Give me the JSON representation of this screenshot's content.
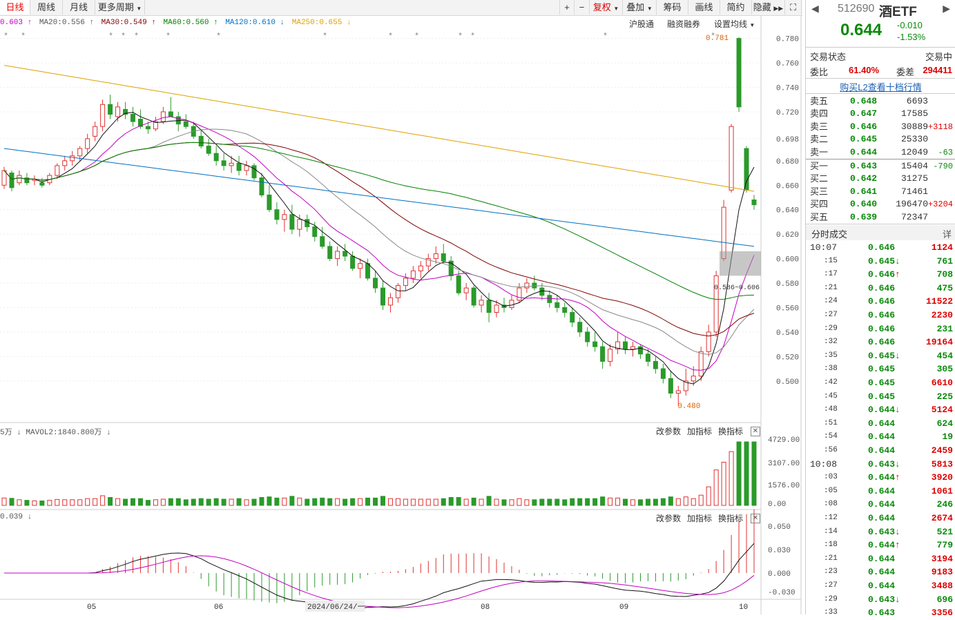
{
  "toolbar": {
    "tabs": [
      "日线",
      "周线",
      "月线",
      "更多周期"
    ],
    "right_buttons": [
      "+",
      "−",
      "复权",
      "叠加",
      "筹码",
      "画线",
      "简约",
      "隐藏"
    ]
  },
  "ma_legend": [
    {
      "text": "0.603 ↑",
      "color": "#c000c0"
    },
    {
      "text": "MA20:0.556 ↑",
      "color": "#555555"
    },
    {
      "text": "MA30:0.549 ↑",
      "color": "#800000"
    },
    {
      "text": "MA60:0.560 ↑",
      "color": "#008000"
    },
    {
      "text": "MA120:0.610 ↓",
      "color": "#0070c0"
    },
    {
      "text": "MA250:0.655 ↓",
      "color": "#e0a000"
    }
  ],
  "chart_links": [
    "沪股通",
    "融资融券",
    "设置均线"
  ],
  "chart_data": {
    "type": "candlestick",
    "price_axis": {
      "ticks": [
        "0.780",
        "0.760",
        "0.740",
        "0.720",
        "0.698",
        "0.680",
        "0.660",
        "0.640",
        "0.620",
        "0.600",
        "0.580",
        "0.560",
        "0.540",
        "0.520",
        "0.500"
      ],
      "ylim": [
        0.466,
        0.786
      ]
    },
    "annotations": {
      "high": "0.781",
      "low": "0.480",
      "range_label": "0.586~0.606"
    },
    "x_labels": [
      "05",
      "06",
      "2024/06/24/一",
      "08",
      "09",
      "10"
    ],
    "candles": [
      [
        0.66,
        0.675,
        0.657,
        0.672
      ],
      [
        0.67,
        0.672,
        0.655,
        0.658
      ],
      [
        0.662,
        0.672,
        0.66,
        0.668
      ],
      [
        0.666,
        0.67,
        0.66,
        0.662
      ],
      [
        0.664,
        0.668,
        0.66,
        0.665
      ],
      [
        0.662,
        0.666,
        0.658,
        0.66
      ],
      [
        0.662,
        0.67,
        0.66,
        0.668
      ],
      [
        0.668,
        0.678,
        0.665,
        0.676
      ],
      [
        0.676,
        0.684,
        0.672,
        0.68
      ],
      [
        0.68,
        0.688,
        0.676,
        0.684
      ],
      [
        0.684,
        0.692,
        0.68,
        0.69
      ],
      [
        0.69,
        0.702,
        0.686,
        0.698
      ],
      [
        0.7,
        0.712,
        0.696,
        0.708
      ],
      [
        0.708,
        0.73,
        0.704,
        0.726
      ],
      [
        0.726,
        0.734,
        0.714,
        0.718
      ],
      [
        0.716,
        0.728,
        0.712,
        0.724
      ],
      [
        0.722,
        0.728,
        0.714,
        0.718
      ],
      [
        0.718,
        0.724,
        0.708,
        0.712
      ],
      [
        0.714,
        0.722,
        0.706,
        0.708
      ],
      [
        0.708,
        0.712,
        0.702,
        0.706
      ],
      [
        0.706,
        0.716,
        0.704,
        0.712
      ],
      [
        0.712,
        0.724,
        0.71,
        0.72
      ],
      [
        0.72,
        0.732,
        0.716,
        0.716
      ],
      [
        0.716,
        0.72,
        0.704,
        0.71
      ],
      [
        0.712,
        0.718,
        0.706,
        0.708
      ],
      [
        0.708,
        0.712,
        0.698,
        0.7
      ],
      [
        0.7,
        0.706,
        0.69,
        0.692
      ],
      [
        0.692,
        0.698,
        0.684,
        0.686
      ],
      [
        0.686,
        0.692,
        0.676,
        0.68
      ],
      [
        0.68,
        0.686,
        0.672,
        0.676
      ],
      [
        0.676,
        0.684,
        0.67,
        0.678
      ],
      [
        0.678,
        0.684,
        0.668,
        0.672
      ],
      [
        0.672,
        0.68,
        0.668,
        0.676
      ],
      [
        0.676,
        0.678,
        0.664,
        0.666
      ],
      [
        0.666,
        0.67,
        0.65,
        0.652
      ],
      [
        0.652,
        0.66,
        0.638,
        0.64
      ],
      [
        0.64,
        0.646,
        0.628,
        0.632
      ],
      [
        0.632,
        0.64,
        0.622,
        0.636
      ],
      [
        0.636,
        0.644,
        0.62,
        0.624
      ],
      [
        0.624,
        0.636,
        0.618,
        0.632
      ],
      [
        0.632,
        0.636,
        0.622,
        0.626
      ],
      [
        0.626,
        0.63,
        0.614,
        0.618
      ],
      [
        0.618,
        0.626,
        0.608,
        0.61
      ],
      [
        0.61,
        0.614,
        0.598,
        0.6
      ],
      [
        0.6,
        0.61,
        0.594,
        0.606
      ],
      [
        0.606,
        0.612,
        0.598,
        0.602
      ],
      [
        0.602,
        0.606,
        0.59,
        0.592
      ],
      [
        0.592,
        0.6,
        0.584,
        0.596
      ],
      [
        0.596,
        0.6,
        0.582,
        0.584
      ],
      [
        0.584,
        0.59,
        0.572,
        0.576
      ],
      [
        0.576,
        0.582,
        0.558,
        0.562
      ],
      [
        0.562,
        0.572,
        0.556,
        0.568
      ],
      [
        0.568,
        0.58,
        0.564,
        0.578
      ],
      [
        0.578,
        0.588,
        0.574,
        0.584
      ],
      [
        0.584,
        0.594,
        0.58,
        0.59
      ],
      [
        0.59,
        0.598,
        0.584,
        0.594
      ],
      [
        0.594,
        0.604,
        0.59,
        0.6
      ],
      [
        0.6,
        0.61,
        0.596,
        0.604
      ],
      [
        0.604,
        0.612,
        0.596,
        0.598
      ],
      [
        0.598,
        0.602,
        0.582,
        0.586
      ],
      [
        0.586,
        0.59,
        0.57,
        0.572
      ],
      [
        0.572,
        0.58,
        0.566,
        0.576
      ],
      [
        0.576,
        0.578,
        0.56,
        0.562
      ],
      [
        0.562,
        0.57,
        0.556,
        0.566
      ],
      [
        0.566,
        0.572,
        0.548,
        0.556
      ],
      [
        0.556,
        0.566,
        0.552,
        0.562
      ],
      [
        0.562,
        0.568,
        0.556,
        0.56
      ],
      [
        0.56,
        0.57,
        0.558,
        0.566
      ],
      [
        0.566,
        0.58,
        0.564,
        0.576
      ],
      [
        0.576,
        0.584,
        0.572,
        0.58
      ],
      [
        0.58,
        0.586,
        0.574,
        0.576
      ],
      [
        0.576,
        0.58,
        0.566,
        0.57
      ],
      [
        0.57,
        0.574,
        0.56,
        0.564
      ],
      [
        0.564,
        0.57,
        0.556,
        0.56
      ],
      [
        0.56,
        0.564,
        0.552,
        0.556
      ],
      [
        0.556,
        0.56,
        0.544,
        0.548
      ],
      [
        0.548,
        0.552,
        0.536,
        0.54
      ],
      [
        0.54,
        0.544,
        0.528,
        0.532
      ],
      [
        0.532,
        0.54,
        0.524,
        0.528
      ],
      [
        0.528,
        0.532,
        0.51,
        0.516
      ],
      [
        0.516,
        0.53,
        0.512,
        0.526
      ],
      [
        0.526,
        0.54,
        0.522,
        0.532
      ],
      [
        0.532,
        0.536,
        0.522,
        0.526
      ],
      [
        0.526,
        0.532,
        0.52,
        0.528
      ],
      [
        0.528,
        0.53,
        0.518,
        0.522
      ],
      [
        0.522,
        0.526,
        0.512,
        0.516
      ],
      [
        0.516,
        0.52,
        0.506,
        0.51
      ],
      [
        0.51,
        0.514,
        0.498,
        0.502
      ],
      [
        0.502,
        0.508,
        0.486,
        0.49
      ],
      [
        0.49,
        0.496,
        0.48,
        0.492
      ],
      [
        0.492,
        0.51,
        0.488,
        0.5
      ],
      [
        0.5,
        0.512,
        0.496,
        0.504
      ],
      [
        0.504,
        0.528,
        0.5,
        0.524
      ],
      [
        0.524,
        0.546,
        0.52,
        0.54
      ],
      [
        0.54,
        0.59,
        0.536,
        0.586
      ],
      [
        0.6,
        0.648,
        0.598,
        0.642
      ],
      [
        0.656,
        0.71,
        0.654,
        0.708
      ],
      [
        0.78,
        0.781,
        0.72,
        0.724
      ],
      [
        0.69,
        0.692,
        0.654,
        0.656
      ],
      [
        0.648,
        0.652,
        0.64,
        0.644
      ]
    ]
  },
  "volume_panel": {
    "label": "5万 ↓ MAVOL2:1840.800万 ↓",
    "ticks": [
      "4729.00",
      "3107.00",
      "1576.00",
      "0.00"
    ],
    "links": [
      "改参数",
      "加指标",
      "换指标"
    ]
  },
  "macd_panel": {
    "label": "0.039 ↓",
    "ticks": [
      "0.050",
      "0.030",
      "0.000",
      "-0.030"
    ],
    "links": [
      "改参数",
      "加指标",
      "换指标"
    ]
  },
  "sidebar": {
    "code": "512690",
    "name": "酒ETF",
    "price": "0.644",
    "change": "-0.010",
    "change_pct": "-1.53%",
    "status_label": "交易状态",
    "status_value": "交易中",
    "ratio_label": "委比",
    "ratio_value": "61.40%",
    "diff_label": "委差",
    "diff_value": "294411",
    "l2_link": "购买L2查看十档行情",
    "asks": [
      {
        "label": "卖五",
        "price": "0.648",
        "vol": "6693",
        "chg": ""
      },
      {
        "label": "卖四",
        "price": "0.647",
        "vol": "17585",
        "chg": ""
      },
      {
        "label": "卖三",
        "price": "0.646",
        "vol": "30889",
        "chg": "+3118"
      },
      {
        "label": "卖二",
        "price": "0.645",
        "vol": "25330",
        "chg": ""
      },
      {
        "label": "卖一",
        "price": "0.644",
        "vol": "12049",
        "chg": "-63"
      }
    ],
    "bids": [
      {
        "label": "买一",
        "price": "0.643",
        "vol": "15404",
        "chg": "-790"
      },
      {
        "label": "买二",
        "price": "0.642",
        "vol": "31275",
        "chg": ""
      },
      {
        "label": "买三",
        "price": "0.641",
        "vol": "71461",
        "chg": ""
      },
      {
        "label": "买四",
        "price": "0.640",
        "vol": "196470",
        "chg": "+3204"
      },
      {
        "label": "买五",
        "price": "0.639",
        "vol": "72347",
        "chg": ""
      }
    ],
    "ticks_title": "分时成交",
    "ticks_detail": "详",
    "ticks": [
      {
        "t": "10:07",
        "p": "0.646",
        "a": "",
        "v": "1124"
      },
      {
        "t": ":15",
        "p": "0.645",
        "a": "↓",
        "v": "761"
      },
      {
        "t": ":17",
        "p": "0.646",
        "a": "↑",
        "v": "708"
      },
      {
        "t": ":21",
        "p": "0.646",
        "a": "",
        "v": "475"
      },
      {
        "t": ":24",
        "p": "0.646",
        "a": "",
        "v": "11522"
      },
      {
        "t": ":27",
        "p": "0.646",
        "a": "",
        "v": "2230"
      },
      {
        "t": ":29",
        "p": "0.646",
        "a": "",
        "v": "231"
      },
      {
        "t": ":32",
        "p": "0.646",
        "a": "",
        "v": "19164"
      },
      {
        "t": ":35",
        "p": "0.645",
        "a": "↓",
        "v": "454"
      },
      {
        "t": ":38",
        "p": "0.645",
        "a": "",
        "v": "305"
      },
      {
        "t": ":42",
        "p": "0.645",
        "a": "",
        "v": "6610"
      },
      {
        "t": ":45",
        "p": "0.645",
        "a": "",
        "v": "225"
      },
      {
        "t": ":48",
        "p": "0.644",
        "a": "↓",
        "v": "5124"
      },
      {
        "t": ":51",
        "p": "0.644",
        "a": "",
        "v": "624"
      },
      {
        "t": ":54",
        "p": "0.644",
        "a": "",
        "v": "19"
      },
      {
        "t": ":56",
        "p": "0.644",
        "a": "",
        "v": "2459"
      },
      {
        "t": "10:08",
        "p": "0.643",
        "a": "↓",
        "v": "5813"
      },
      {
        "t": ":03",
        "p": "0.644",
        "a": "↑",
        "v": "3920"
      },
      {
        "t": ":05",
        "p": "0.644",
        "a": "",
        "v": "1061"
      },
      {
        "t": ":08",
        "p": "0.644",
        "a": "",
        "v": "246"
      },
      {
        "t": ":12",
        "p": "0.644",
        "a": "",
        "v": "2674"
      },
      {
        "t": ":14",
        "p": "0.643",
        "a": "↓",
        "v": "521"
      },
      {
        "t": ":18",
        "p": "0.644",
        "a": "↑",
        "v": "779"
      },
      {
        "t": ":21",
        "p": "0.644",
        "a": "",
        "v": "3194"
      },
      {
        "t": ":23",
        "p": "0.644",
        "a": "",
        "v": "9183"
      },
      {
        "t": ":27",
        "p": "0.644",
        "a": "",
        "v": "3488"
      },
      {
        "t": ":29",
        "p": "0.643",
        "a": "↓",
        "v": "696"
      },
      {
        "t": ":33",
        "p": "0.643",
        "a": "",
        "v": "3356"
      }
    ]
  }
}
